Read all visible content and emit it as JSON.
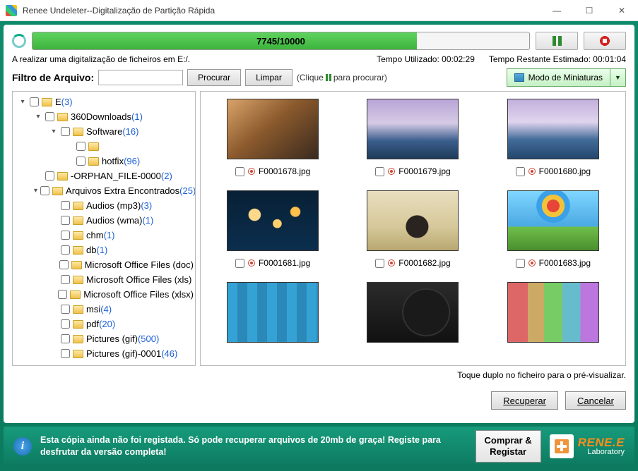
{
  "window": {
    "title": "Renee Undeleter--Digitalização de Partição Rápida"
  },
  "progress": {
    "label": "7745/10000",
    "percent": 77.45
  },
  "status": {
    "scanning": "A realizar uma digitalização de ficheiros em E:/.",
    "elapsed_label": "Tempo Utilizado: ",
    "elapsed_value": "00:02:29",
    "remaining_label": "Tempo Restante Estimado: ",
    "remaining_value": "00:01:04"
  },
  "filter": {
    "label": "Filtro de Arquivo:",
    "value": "",
    "search_btn": "Procurar",
    "clear_btn": "Limpar",
    "hint_pre": "(Clique",
    "hint_post": "para procurar)"
  },
  "view_mode": {
    "label": "Modo de Miniaturas"
  },
  "tree": [
    {
      "indent": 0,
      "expander": "▾",
      "name": "E ",
      "count": "(3)"
    },
    {
      "indent": 1,
      "expander": "▾",
      "name": "360Downloads ",
      "count": "(1)"
    },
    {
      "indent": 2,
      "expander": "▾",
      "name": "Software ",
      "count": "(16)"
    },
    {
      "indent": 3,
      "expander": "",
      "name": "",
      "count": ""
    },
    {
      "indent": 3,
      "expander": "",
      "name": "hotfix ",
      "count": "(96)"
    },
    {
      "indent": 1,
      "expander": "",
      "name": "-ORPHAN_FILE-0000 ",
      "count": "(2)"
    },
    {
      "indent": 1,
      "expander": "▾",
      "name": "Arquivos Extra Encontrados ",
      "count": "(25)"
    },
    {
      "indent": 2,
      "expander": "",
      "name": "Audios (mp3) ",
      "count": "(3)"
    },
    {
      "indent": 2,
      "expander": "",
      "name": "Audios (wma) ",
      "count": "(1)"
    },
    {
      "indent": 2,
      "expander": "",
      "name": "chm ",
      "count": "(1)"
    },
    {
      "indent": 2,
      "expander": "",
      "name": "db ",
      "count": "(1)"
    },
    {
      "indent": 2,
      "expander": "",
      "name": "Microsoft Office Files (doc)",
      "count": ""
    },
    {
      "indent": 2,
      "expander": "",
      "name": "Microsoft Office Files (xls)",
      "count": ""
    },
    {
      "indent": 2,
      "expander": "",
      "name": "Microsoft Office Files (xlsx)",
      "count": ""
    },
    {
      "indent": 2,
      "expander": "",
      "name": "msi ",
      "count": "(4)"
    },
    {
      "indent": 2,
      "expander": "",
      "name": "pdf ",
      "count": "(20)"
    },
    {
      "indent": 2,
      "expander": "",
      "name": "Pictures (gif) ",
      "count": "(500)"
    },
    {
      "indent": 2,
      "expander": "",
      "name": "Pictures (gif)-0001 ",
      "count": "(46)"
    }
  ],
  "thumbs": [
    {
      "bg": "bg1",
      "name": "F0001678.jpg"
    },
    {
      "bg": "bg2",
      "name": "F0001679.jpg"
    },
    {
      "bg": "bg3",
      "name": "F0001680.jpg"
    },
    {
      "bg": "bg4",
      "name": "F0001681.jpg"
    },
    {
      "bg": "bg5",
      "name": "F0001682.jpg"
    },
    {
      "bg": "bg6",
      "name": "F0001683.jpg"
    },
    {
      "bg": "bg7",
      "name": ""
    },
    {
      "bg": "bg8",
      "name": ""
    },
    {
      "bg": "bg9",
      "name": ""
    }
  ],
  "preview_hint": "Toque duplo no ficheiro para o pré-visualizar.",
  "actions": {
    "recover": "Recuperar",
    "cancel": "Cancelar"
  },
  "footer": {
    "text": "Esta cópia ainda não foi registada. Só pode recuperar arquivos de 20mb de graça! Registe para desfrutar da versão completa!",
    "buy_line1": "Comprar &",
    "buy_line2": "Registar",
    "logo_top": "RENE.E",
    "logo_bot": "Laboratory"
  }
}
